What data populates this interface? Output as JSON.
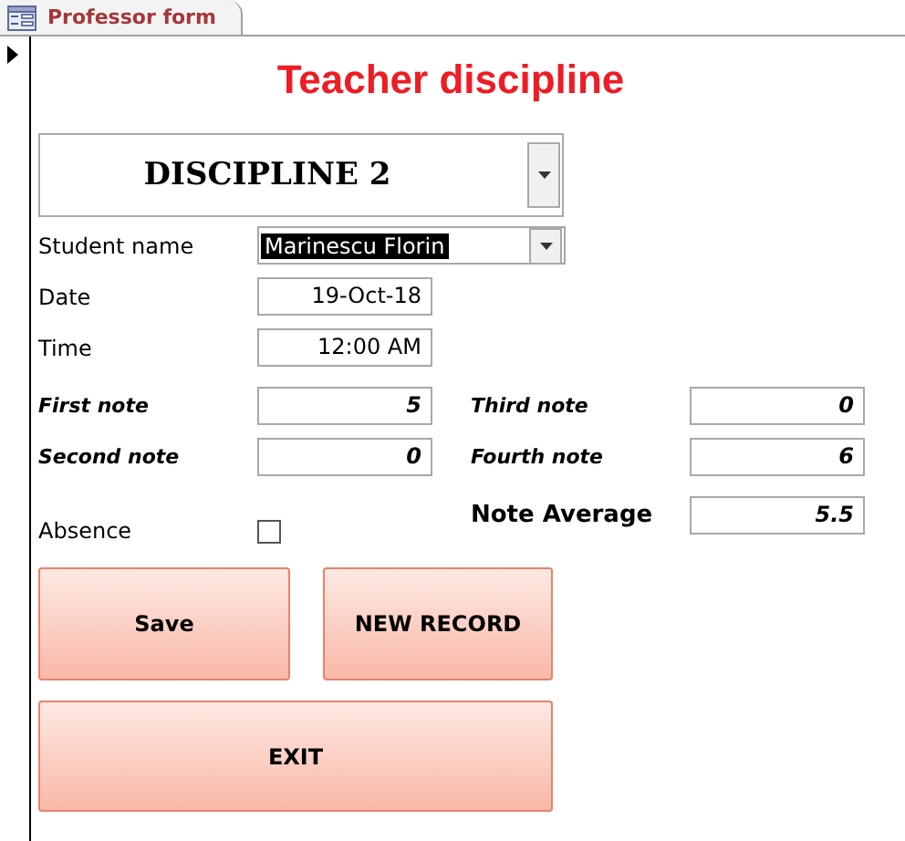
{
  "tab": {
    "title": "Professor form"
  },
  "heading": "Teacher discipline",
  "discipline": {
    "value": "DISCIPLINE 2"
  },
  "student": {
    "label": "Student name",
    "value": "Marinescu Florin"
  },
  "date": {
    "label": "Date",
    "value": "19-Oct-18"
  },
  "time": {
    "label": "Time",
    "value": "12:00 AM"
  },
  "notes": [
    {
      "label": "First note",
      "value": "5"
    },
    {
      "label": "Second note",
      "value": "0"
    },
    {
      "label": "Third note",
      "value": "0"
    },
    {
      "label": "Fourth note",
      "value": "6"
    }
  ],
  "absence": {
    "label": "Absence",
    "checked": false
  },
  "note_average": {
    "label": "Note Average",
    "value": "5.5"
  },
  "buttons": [
    {
      "label": "Save"
    },
    {
      "label": "NEW RECORD"
    },
    {
      "label": "EXIT"
    }
  ]
}
